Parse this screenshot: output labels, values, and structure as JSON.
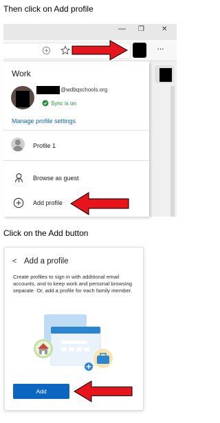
{
  "instructions": {
    "step1": "Then click on Add profile",
    "step2": "Click on the Add button"
  },
  "browser": {
    "window_controls": {
      "minimize_glyph": "—",
      "restore_glyph": "❐",
      "close_glyph": "✕"
    },
    "toolbar": {
      "more_glyph": "···"
    }
  },
  "profile_menu": {
    "heading": "Work",
    "email_suffix": "@wdbqschools.org",
    "sync_status": "Sync is on",
    "manage_link": "Manage profile settings",
    "other_profile": "Profile 1",
    "browse_guest": "Browse as guest",
    "add_profile": "Add profile"
  },
  "add_profile_dialog": {
    "title": "Add a profile",
    "back_glyph": "<",
    "description": "Create profiles to sign in with additional email accounts, and to keep work and personal browsing separate. Or, add a profile for each family member.",
    "add_button": "Add"
  },
  "colors": {
    "arrow_red": "#e8141b",
    "accent_blue": "#0b66c2",
    "sync_green": "#1e8a3c"
  }
}
